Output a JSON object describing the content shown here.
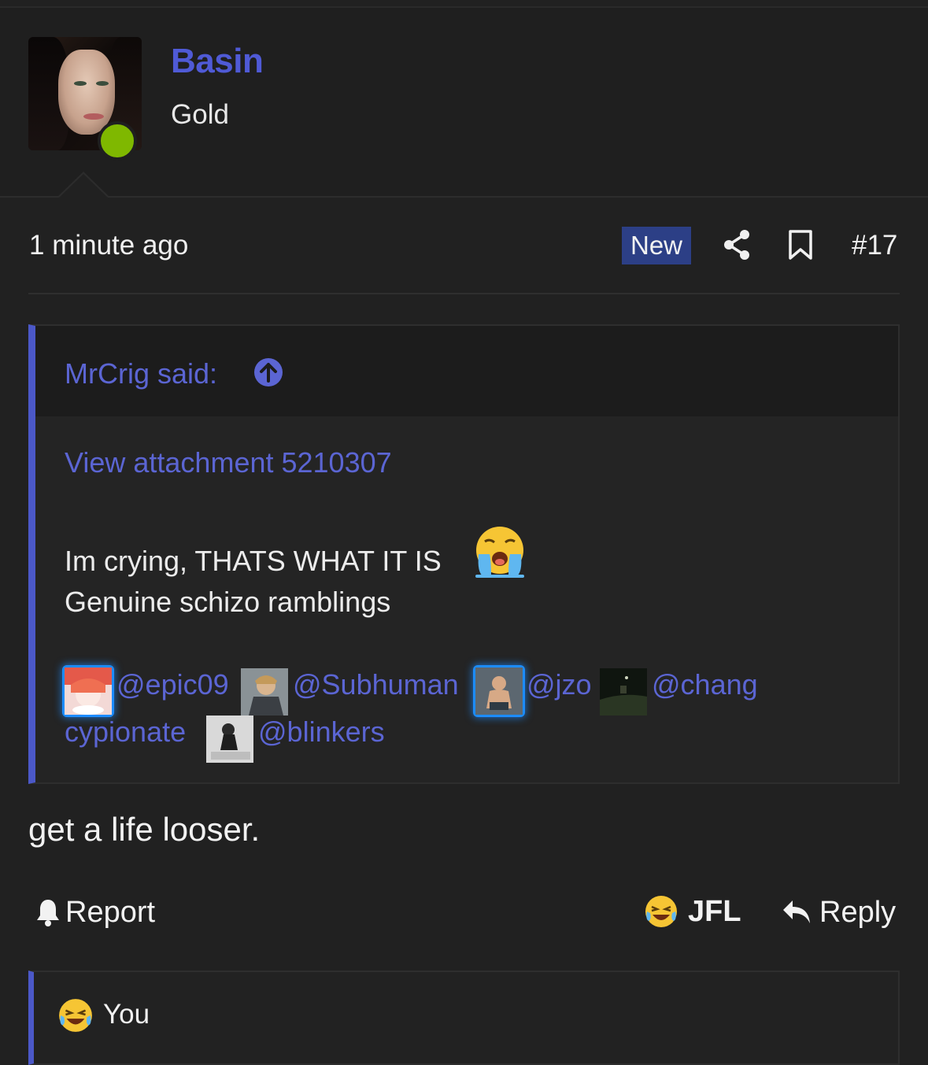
{
  "user": {
    "name": "Basin",
    "title": "Gold",
    "status": "online"
  },
  "post": {
    "timestamp": "1 minute ago",
    "badge": "New",
    "number": "#17",
    "icons": {
      "share": "share-icon",
      "bookmark": "bookmark-icon"
    }
  },
  "quote": {
    "author_label": "MrCrig said:",
    "attachment_link": "View attachment 5210307",
    "line1": "Im crying, THATS WHAT IT IS",
    "line2": "Genuine schizo ramblings",
    "emoji": "loudly-crying-face",
    "mentions": [
      "@epic09",
      "@Subhuman",
      "@jzo",
      "@chang",
      "cypionate",
      "@blinkers"
    ]
  },
  "reply_text": "get a life looser.",
  "actions": {
    "report": "Report",
    "reaction": "JFL",
    "reply": "Reply"
  },
  "reactions": {
    "user": "You",
    "emoji": "tears-of-joy-face"
  },
  "colors": {
    "background": "#212121",
    "link": "#5b65d3",
    "username": "#4f5ad6",
    "quote_bar": "#4b58c8",
    "online": "#7fb800",
    "new_badge": "#2c3f86"
  }
}
